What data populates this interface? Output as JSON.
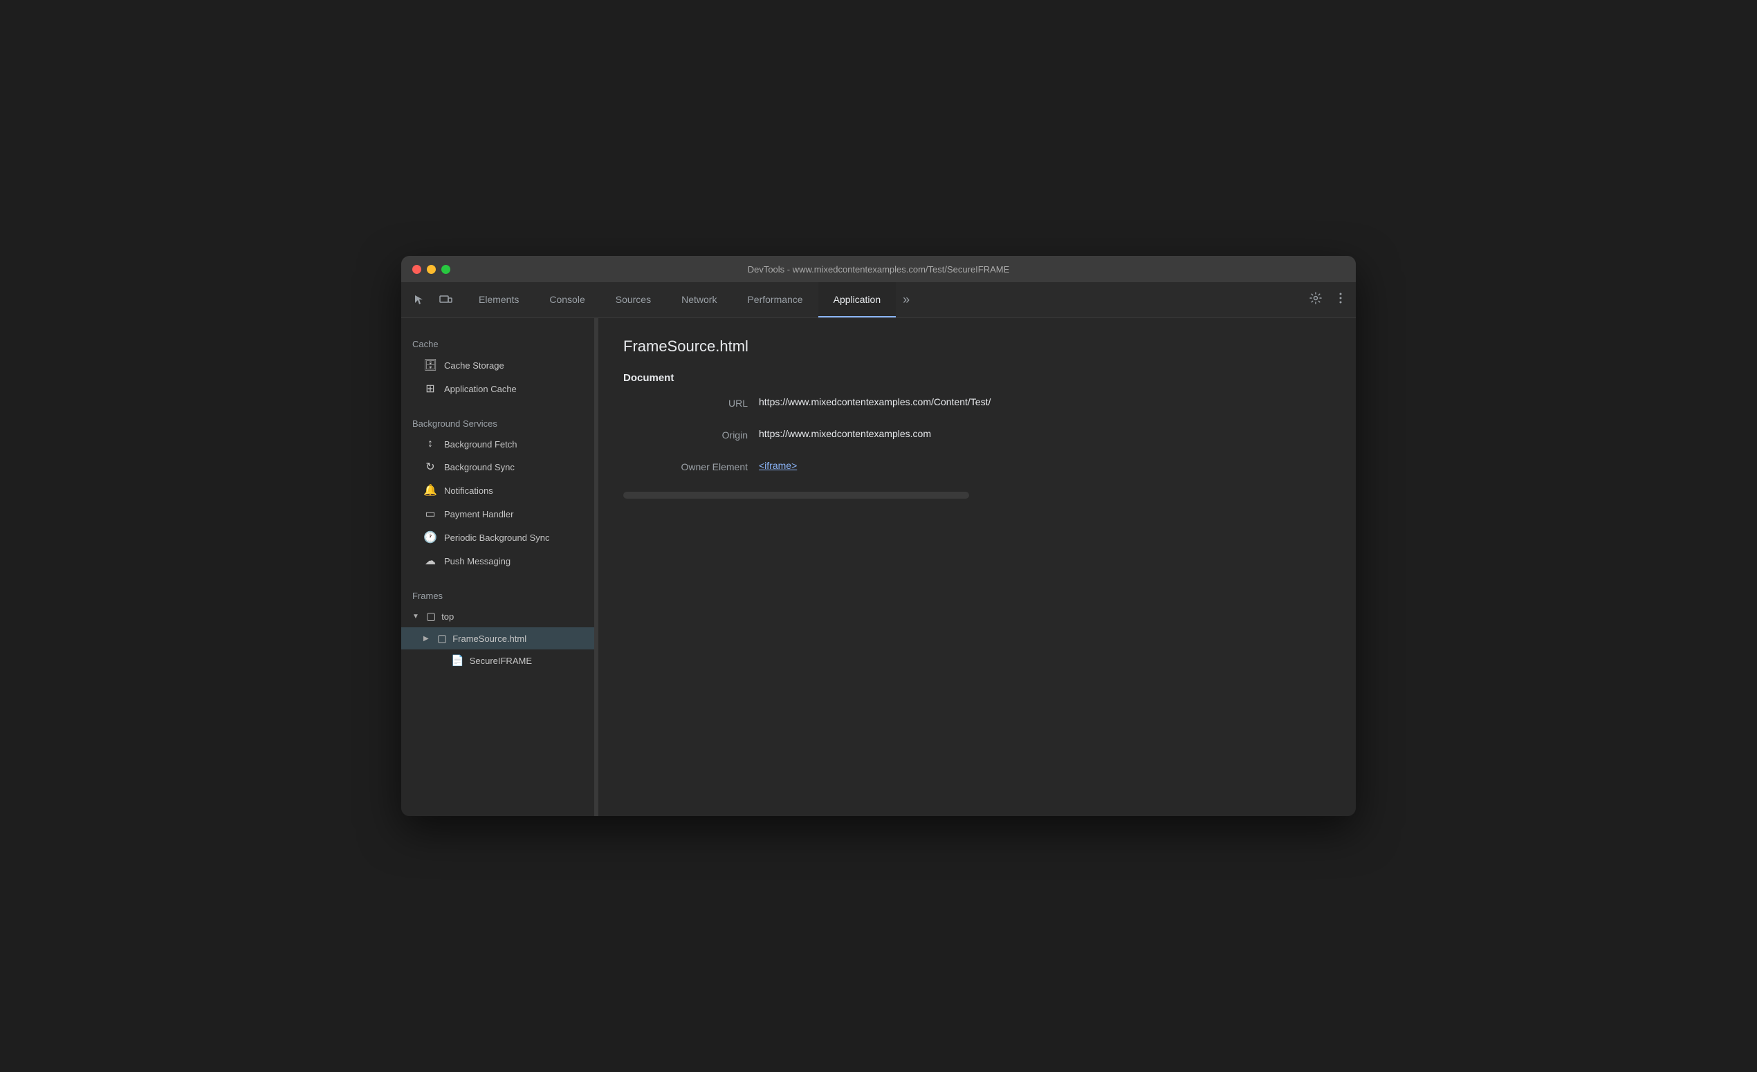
{
  "window": {
    "title": "DevTools - www.mixedcontentexamples.com/Test/SecureIFRAME"
  },
  "tabs": {
    "items": [
      {
        "label": "Elements",
        "active": false
      },
      {
        "label": "Console",
        "active": false
      },
      {
        "label": "Sources",
        "active": false
      },
      {
        "label": "Network",
        "active": false
      },
      {
        "label": "Performance",
        "active": false
      },
      {
        "label": "Application",
        "active": true
      }
    ],
    "more_label": "»"
  },
  "sidebar": {
    "cache_section": "Cache",
    "cache_items": [
      {
        "label": "Cache Storage",
        "icon": "🗄"
      },
      {
        "label": "Application Cache",
        "icon": "⊞"
      }
    ],
    "bg_section": "Background Services",
    "bg_items": [
      {
        "label": "Background Fetch",
        "icon": "↕"
      },
      {
        "label": "Background Sync",
        "icon": "↻"
      },
      {
        "label": "Notifications",
        "icon": "🔔"
      },
      {
        "label": "Payment Handler",
        "icon": "▭"
      },
      {
        "label": "Periodic Background Sync",
        "icon": "🕐"
      },
      {
        "label": "Push Messaging",
        "icon": "☁"
      }
    ],
    "frames_section": "Frames",
    "frames": {
      "top": {
        "label": "top",
        "children": [
          {
            "label": "FrameSource.html",
            "selected": true,
            "children": [
              {
                "label": "SecureIFRAME"
              }
            ]
          }
        ]
      }
    }
  },
  "content": {
    "title": "FrameSource.html",
    "document_heading": "Document",
    "fields": [
      {
        "label": "URL",
        "value": "https://www.mixedcontentexamples.com/Content/Test/",
        "type": "text"
      },
      {
        "label": "Origin",
        "value": "https://www.mixedcontentexamples.com",
        "type": "text"
      },
      {
        "label": "Owner Element",
        "value": "<iframe>",
        "type": "link"
      }
    ]
  }
}
